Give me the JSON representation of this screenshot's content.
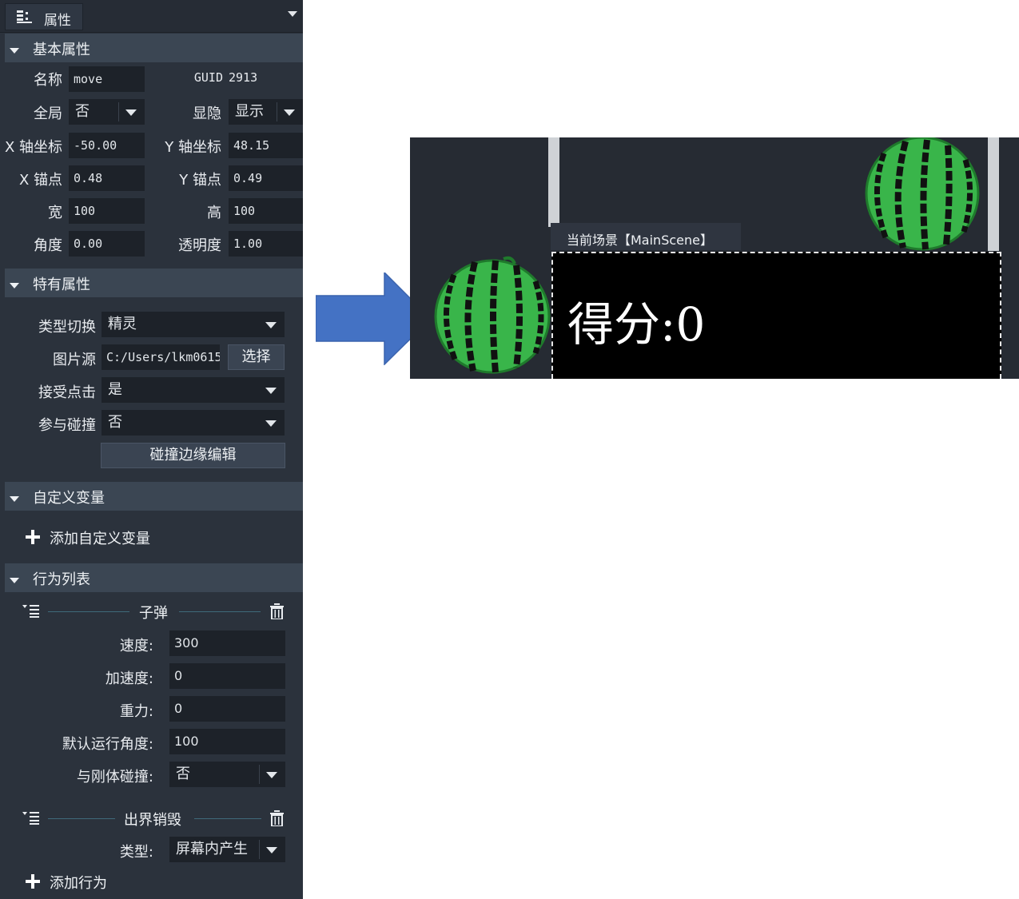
{
  "panel": {
    "tab_title": "属性",
    "sections": {
      "basic": "基本属性",
      "special": "特有属性",
      "custom_vars": "自定义变量",
      "behaviors": "行为列表"
    },
    "basic": {
      "name_label": "名称",
      "name_value": "move",
      "guid_label": "GUID",
      "guid_value": "2913",
      "global_label": "全局",
      "global_value": "否",
      "visibility_label": "显隐",
      "visibility_value": "显示",
      "x_coord_label": "X 轴坐标",
      "x_coord_value": "-50.00",
      "y_coord_label": "Y 轴坐标",
      "y_coord_value": "48.15",
      "x_anchor_label": "X 锚点",
      "x_anchor_value": "0.48",
      "y_anchor_label": "Y 锚点",
      "y_anchor_value": "0.49",
      "width_label": "宽",
      "width_value": "100",
      "height_label": "高",
      "height_value": "100",
      "angle_label": "角度",
      "angle_value": "0.00",
      "opacity_label": "透明度",
      "opacity_value": "1.00"
    },
    "special": {
      "type_label": "类型切换",
      "type_value": "精灵",
      "image_label": "图片源",
      "image_value": "C:/Users/lkm0615",
      "choose_button": "选择",
      "accept_click_label": "接受点击",
      "accept_click_value": "是",
      "collision_label": "参与碰撞",
      "collision_value": "否",
      "edit_edge_button": "碰撞边缘编辑"
    },
    "custom_vars": {
      "add_label": "添加自定义变量"
    },
    "behaviors": {
      "bullet": {
        "title": "子弹",
        "speed_label": "速度:",
        "speed_value": "300",
        "accel_label": "加速度:",
        "accel_value": "0",
        "gravity_label": "重力:",
        "gravity_value": "0",
        "default_angle_label": "默认运行角度:",
        "default_angle_value": "100",
        "rigid_label": "与刚体碰撞:",
        "rigid_value": "否"
      },
      "destroy": {
        "title": "出界销毁",
        "type_label": "类型:",
        "type_value": "屏幕内产生"
      },
      "add_label": "添加行为"
    }
  },
  "scene": {
    "tab_label": "当前场景【MainScene】",
    "score_text": "得分:0"
  },
  "colors": {
    "panel_bg": "#2b323c",
    "section_bg": "#3b4653",
    "input_bg": "#1d2229",
    "arrow_fill": "#4472c4",
    "watermelon_green": "#39b54a"
  }
}
